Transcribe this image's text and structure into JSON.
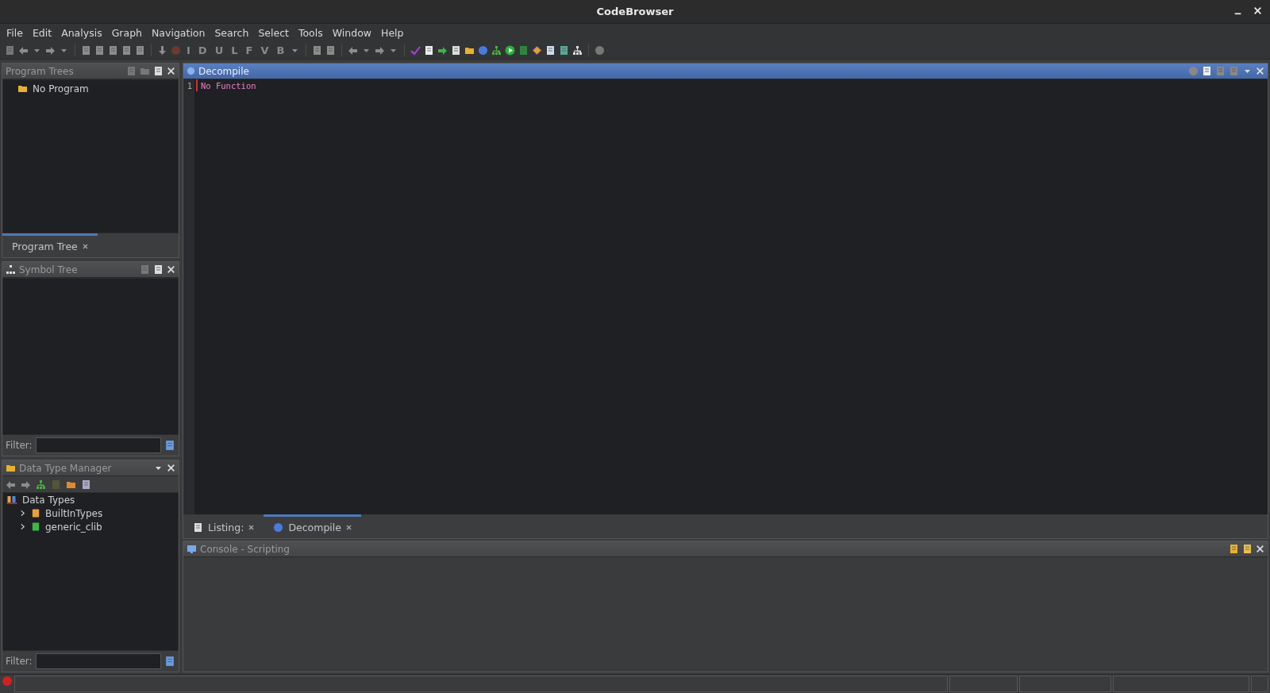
{
  "window": {
    "title": "CodeBrowser"
  },
  "menu": [
    "File",
    "Edit",
    "Analysis",
    "Graph",
    "Navigation",
    "Search",
    "Select",
    "Tools",
    "Window",
    "Help"
  ],
  "toolbar": {
    "letter_buttons": [
      "I",
      "D",
      "U",
      "L",
      "F",
      "V",
      "B"
    ]
  },
  "program_trees": {
    "title": "Program Trees",
    "items": [
      {
        "label": "No Program"
      }
    ],
    "tabs": [
      {
        "label": "Program Tree",
        "selected": true
      }
    ]
  },
  "symbol_tree": {
    "title": "Symbol Tree",
    "filter": {
      "label": "Filter:"
    }
  },
  "data_type_manager": {
    "title": "Data Type Manager",
    "tree": [
      {
        "label": "Data Types",
        "children": [
          {
            "label": "BuiltInTypes",
            "expanded": false,
            "color": "#e8a33a"
          },
          {
            "label": "generic_clib",
            "expanded": false,
            "color": "#3fb54a"
          }
        ]
      }
    ],
    "filter": {
      "label": "Filter:"
    }
  },
  "decompile": {
    "title": "Decompile",
    "lines": [
      {
        "number": "1",
        "text": "No Function"
      }
    ]
  },
  "editor_tabs": [
    {
      "label": "Listing:",
      "kind": "listing",
      "selected": false
    },
    {
      "label": "Decompile",
      "kind": "decompile",
      "selected": true
    }
  ],
  "console": {
    "title": "Console - Scripting"
  }
}
